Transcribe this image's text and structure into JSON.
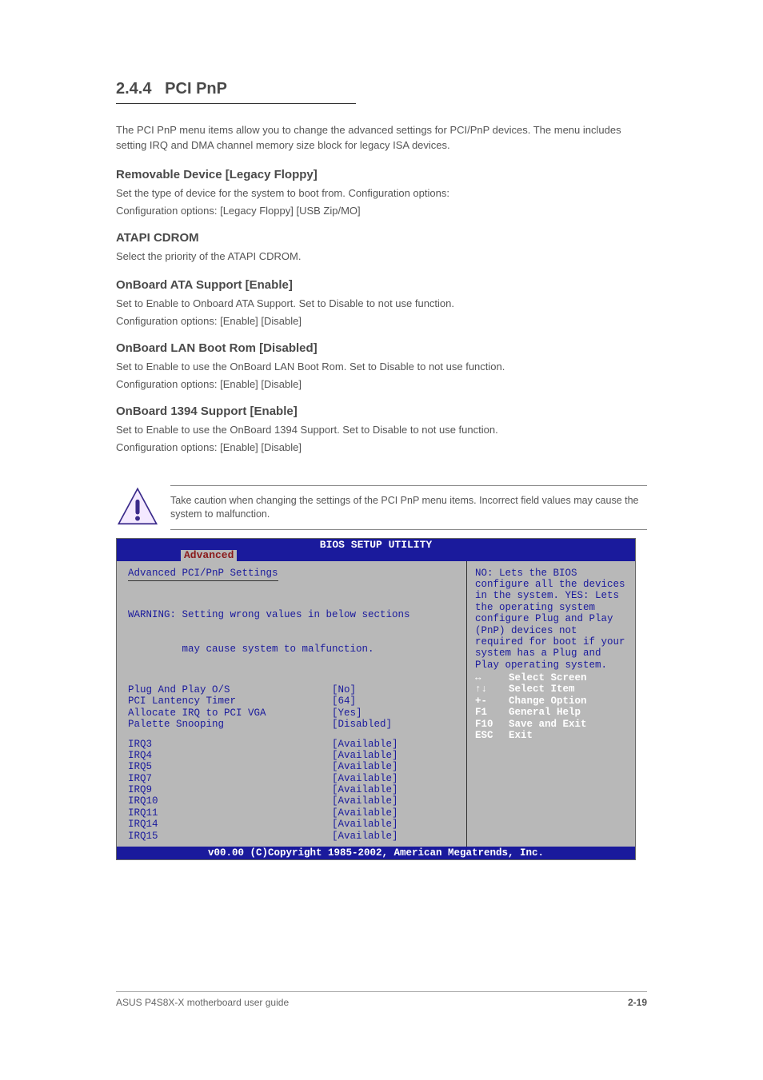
{
  "section_number": "2.4.4",
  "section_title": "PCI PnP",
  "intro": "The PCI PnP menu items allow you to change the advanced settings for PCI/PnP devices. The menu includes setting IRQ and DMA channel memory size block for legacy ISA devices.",
  "block1": {
    "name": "Removable Device [Legacy Floppy]",
    "desc": "Set the type of device for the system to boot from. Configuration options:",
    "options": "Configuration options: [Legacy Floppy] [USB Zip/MO]"
  },
  "block2": {
    "name": "ATAPI CDROM",
    "desc": "Select the priority of the ATAPI CDROM."
  },
  "block3": {
    "name": "OnBoard ATA Support [Enable]",
    "desc": "Set to Enable to Onboard ATA Support. Set to Disable to not use function.",
    "options": "Configuration options: [Enable] [Disable]"
  },
  "block4": {
    "name": "OnBoard LAN Boot Rom [Disabled]",
    "desc": "Set to Enable to use the OnBoard LAN Boot Rom. Set to Disable to not use function.",
    "options": "Configuration options: [Enable] [Disable]"
  },
  "block5": {
    "name": "OnBoard 1394 Support [Enable]",
    "desc": "Set to Enable to use the OnBoard 1394 Support. Set to Disable to not use function.",
    "options": "Configuration options: [Enable] [Disable]"
  },
  "notice": "Take caution when changing the settings of the PCI PnP menu items. Incorrect field values may cause the system to malfunction.",
  "bios": {
    "title": "BIOS SETUP UTILITY",
    "tab": "Advanced",
    "panel_header": "Advanced PCI/PnP Settings",
    "warning_l1": "WARNING: Setting wrong values in below sections",
    "warning_l2": "         may cause system to malfunction.",
    "settings": [
      {
        "label": "Plug And Play O/S",
        "value": "[No]"
      },
      {
        "label": "PCI Lantency Timer",
        "value": "[64]"
      },
      {
        "label": "Allocate IRQ to PCI VGA",
        "value": "[Yes]"
      },
      {
        "label": "Palette Snooping",
        "value": "[Disabled]"
      }
    ],
    "irqs": [
      {
        "label": "IRQ3",
        "value": "[Available]"
      },
      {
        "label": "IRQ4",
        "value": "[Available]"
      },
      {
        "label": "IRQ5",
        "value": "[Available]"
      },
      {
        "label": "IRQ7",
        "value": "[Available]"
      },
      {
        "label": "IRQ9",
        "value": "[Available]"
      },
      {
        "label": "IRQ10",
        "value": "[Available]"
      },
      {
        "label": "IRQ11",
        "value": "[Available]"
      },
      {
        "label": "IRQ14",
        "value": "[Available]"
      },
      {
        "label": "IRQ15",
        "value": "[Available]"
      }
    ],
    "help": "NO: Lets the BIOS configure all the devices in the system. YES: Lets the operating system configure Plug and Play (PnP) devices not required for boot if your system has a Plug and Play operating system.",
    "keys": [
      {
        "sym": "↔",
        "label": "Select Screen"
      },
      {
        "sym": "↑↓",
        "label": "Select Item"
      },
      {
        "sym": "+-",
        "label": "Change Option"
      },
      {
        "sym": "F1",
        "label": "General Help"
      },
      {
        "sym": "F10",
        "label": "Save and Exit"
      },
      {
        "sym": "ESC",
        "label": "Exit"
      }
    ],
    "footer": "v00.00 (C)Copyright 1985-2002, American Megatrends, Inc."
  },
  "footer_left": "ASUS P4S8X-X motherboard user guide",
  "footer_right": "2-19"
}
